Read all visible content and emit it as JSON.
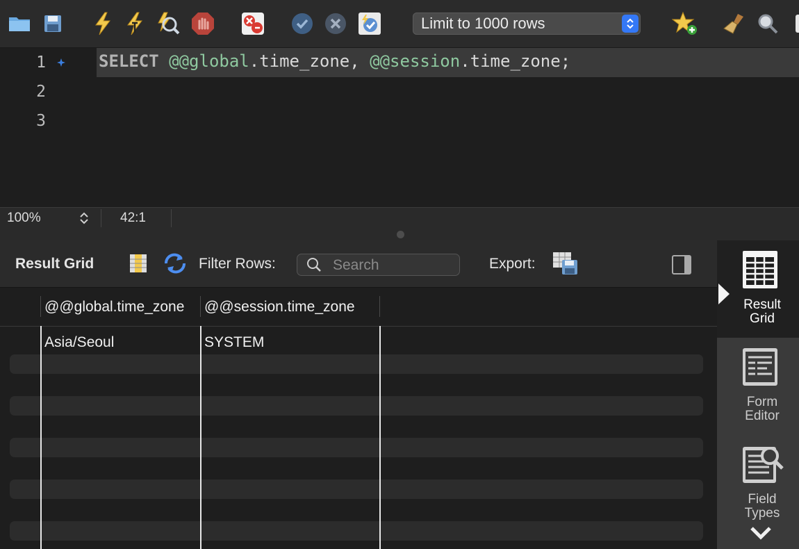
{
  "toolbar": {
    "icons": [
      "open-folder-icon",
      "save-icon",
      "execute-icon",
      "execute-current-icon",
      "explain-icon",
      "stop-icon",
      "toggle-error-icon",
      "commit-icon",
      "rollback-icon",
      "autocommit-icon",
      "add-snippet-icon",
      "beautify-icon",
      "find-icon",
      "invisibles-icon"
    ],
    "limit_label": "Limit to 1000 rows"
  },
  "editor": {
    "line_numbers": [
      "1",
      "2",
      "3"
    ],
    "code": {
      "kw": "SELECT",
      "v1_prefix": "@@global",
      "v1_suffix": ".time_zone",
      "comma": ", ",
      "v2_prefix": "@@session",
      "v2_suffix": ".time_zone",
      "end": ";"
    }
  },
  "status": {
    "zoom": "100%",
    "cursor": "42:1"
  },
  "results": {
    "title": "Result Grid",
    "filter_label": "Filter Rows:",
    "search_placeholder": "Search",
    "export_label": "Export:",
    "columns": [
      "@@global.time_zone",
      "@@session.time_zone"
    ],
    "rows": [
      [
        "Asia/Seoul",
        "SYSTEM"
      ]
    ]
  },
  "side_panel": {
    "items": [
      {
        "line1": "Result",
        "line2": "Grid"
      },
      {
        "line1": "Form",
        "line2": "Editor"
      },
      {
        "line1": "Field",
        "line2": "Types"
      }
    ]
  },
  "colors": {
    "accent": "#3478f6",
    "variable": "#8fc9a0",
    "lightning": "#f2c94c"
  }
}
